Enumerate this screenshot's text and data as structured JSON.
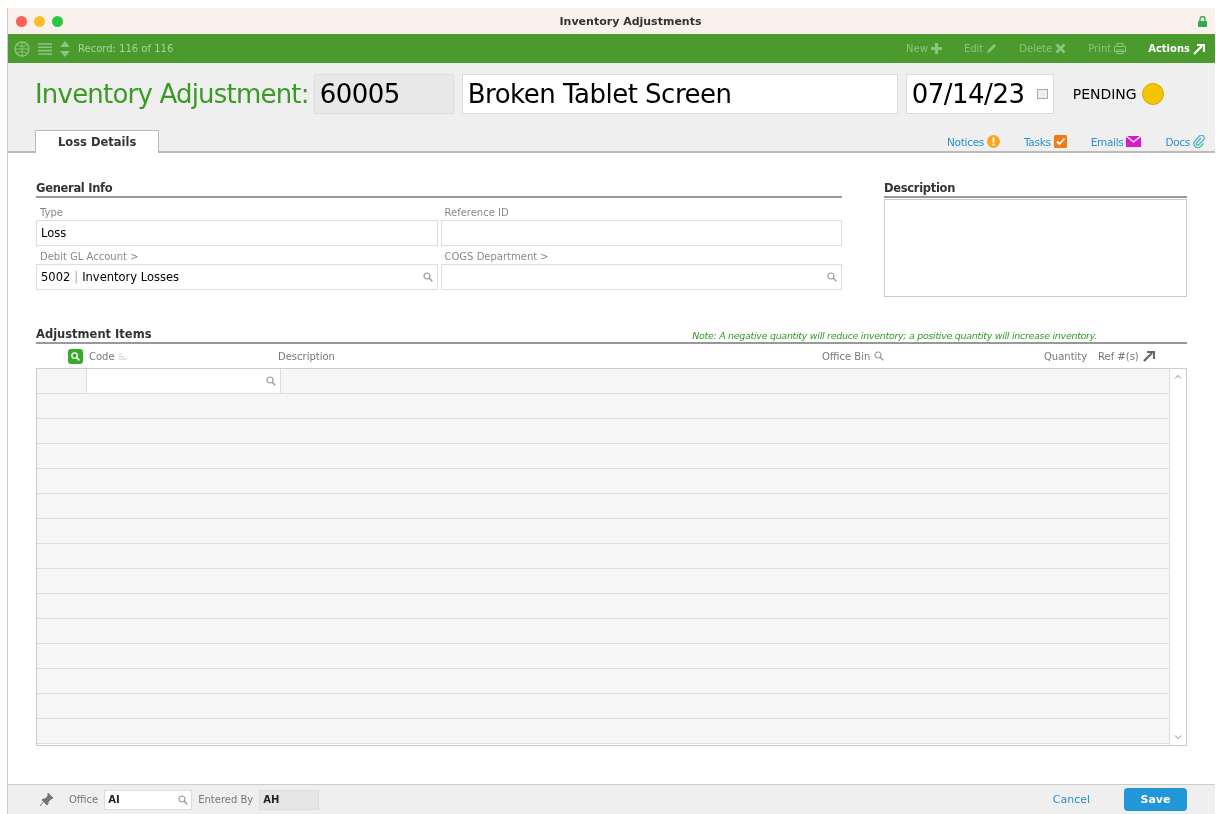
{
  "window": {
    "title": "Inventory Adjustments"
  },
  "toolbar": {
    "record": "Record: 116 of 116",
    "actions": [
      {
        "label": "New",
        "kind": "plus",
        "disabled": true
      },
      {
        "label": "Edit",
        "kind": "pencil",
        "disabled": true
      },
      {
        "label": "Delete",
        "kind": "cross",
        "disabled": true
      },
      {
        "label": "Print",
        "kind": "printer",
        "disabled": true
      },
      {
        "label": "Actions",
        "kind": "arrow",
        "disabled": false
      }
    ]
  },
  "header": {
    "title": "Inventory Adjustment:",
    "number": "60005",
    "name": "Broken Tablet Screen",
    "date": "07/14/23",
    "status": {
      "label": "PENDING",
      "color": "#f5c400"
    }
  },
  "tabs": [
    {
      "label": "Loss Details",
      "selected": true
    }
  ],
  "links": [
    {
      "label": "Notices",
      "kind": "notice"
    },
    {
      "label": "Tasks",
      "kind": "task"
    },
    {
      "label": "Emails",
      "kind": "email"
    },
    {
      "label": "Docs",
      "kind": "clip"
    }
  ],
  "general_info": {
    "heading": "General Info",
    "fields": [
      {
        "label": "Type",
        "value": "Loss",
        "kind": "text"
      },
      {
        "label": "Reference ID",
        "kind": "text"
      },
      {
        "label": "Debit GL Account >",
        "code": "5002",
        "separator": "|",
        "value": "Inventory Losses",
        "kind": "lookup"
      },
      {
        "label": "COGS Department >",
        "kind": "lookup"
      }
    ]
  },
  "description": {
    "heading": "Description"
  },
  "items": {
    "heading": "Adjustment Items",
    "note": "Note: A negative quantity will reduce inventory; a positive quantity will increase inventory.",
    "columns": [
      "Code",
      "Description",
      "Office Bin",
      "Quantity",
      "Ref #(s)"
    ]
  },
  "footer": {
    "office_label": "Office",
    "office": "AI",
    "entered_by_label": "Entered By",
    "entered_by": "AH",
    "cancel": "Cancel",
    "save": "Save"
  }
}
